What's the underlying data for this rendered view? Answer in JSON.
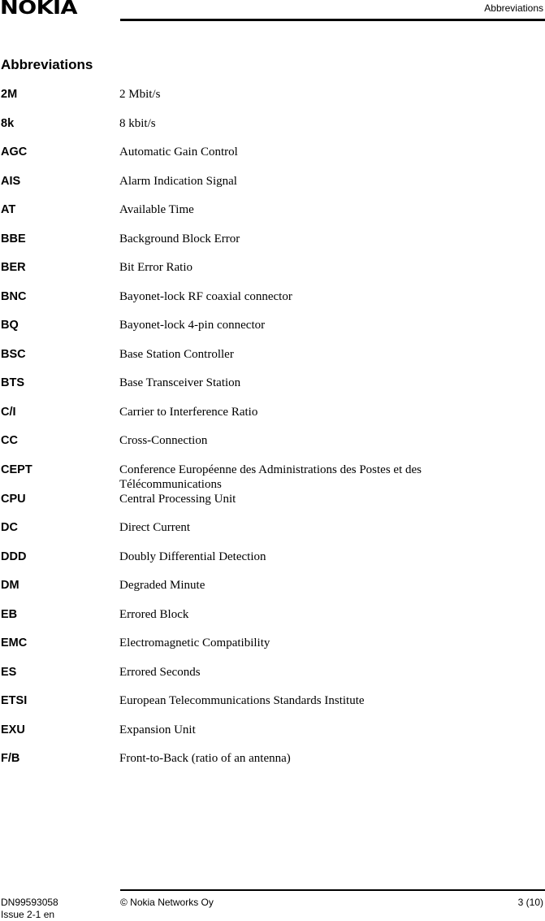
{
  "header": {
    "logo": "NOKIA",
    "section": "Abbreviations"
  },
  "page_title": "Abbreviations",
  "entries": [
    {
      "term": "2M",
      "definition": "2 Mbit/s"
    },
    {
      "term": "8k",
      "definition": "8 kbit/s"
    },
    {
      "term": "AGC",
      "definition": "Automatic Gain Control"
    },
    {
      "term": "AIS",
      "definition": "Alarm Indication Signal"
    },
    {
      "term": "AT",
      "definition": "Available Time"
    },
    {
      "term": "BBE",
      "definition": "Background Block Error"
    },
    {
      "term": "BER",
      "definition": "Bit Error Ratio"
    },
    {
      "term": "BNC",
      "definition": "Bayonet-lock RF coaxial connector"
    },
    {
      "term": "BQ",
      "definition": "Bayonet-lock 4-pin connector"
    },
    {
      "term": "BSC",
      "definition": "Base Station Controller"
    },
    {
      "term": "BTS",
      "definition": "Base Transceiver Station"
    },
    {
      "term": "C/I",
      "definition": "Carrier to Interference Ratio"
    },
    {
      "term": "CC",
      "definition": "Cross-Connection"
    },
    {
      "term": "CEPT",
      "definition": "Conference Européenne des Administrations des Postes et des Télécommunications"
    },
    {
      "term": "CPU",
      "definition": "Central Processing Unit"
    },
    {
      "term": "DC",
      "definition": "Direct Current"
    },
    {
      "term": "DDD",
      "definition": "Doubly Differential Detection"
    },
    {
      "term": "DM",
      "definition": "Degraded Minute"
    },
    {
      "term": "EB",
      "definition": "Errored Block"
    },
    {
      "term": "EMC",
      "definition": "Electromagnetic Compatibility"
    },
    {
      "term": "ES",
      "definition": "Errored Seconds"
    },
    {
      "term": "ETSI",
      "definition": "European Telecommunications Standards Institute"
    },
    {
      "term": "EXU",
      "definition": "Expansion Unit"
    },
    {
      "term": "F/B",
      "definition": "Front-to-Back (ratio of an antenna)"
    }
  ],
  "footer": {
    "doc_number": "DN99593058",
    "issue": "Issue 2-1 en",
    "copyright": "© Nokia Networks Oy",
    "page": "3 (10)"
  }
}
